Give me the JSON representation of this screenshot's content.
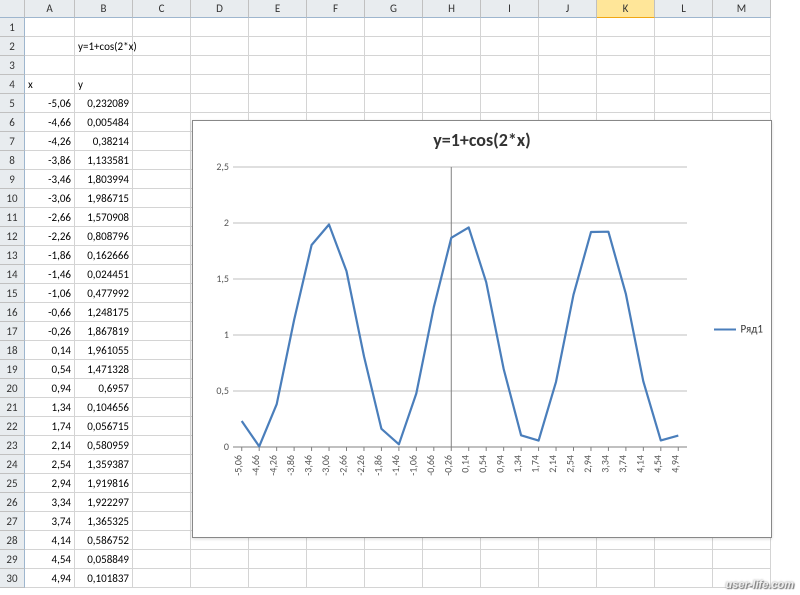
{
  "columns": [
    "A",
    "B",
    "C",
    "D",
    "E",
    "F",
    "G",
    "H",
    "I",
    "J",
    "K",
    "L",
    "M"
  ],
  "selected_column": "K",
  "row_start": 1,
  "row_end": 30,
  "cells": {
    "B2": "y=1+cos(2*x)",
    "A4": "x",
    "B4": "y"
  },
  "table_start_row": 5,
  "table": [
    {
      "x": "-5,06",
      "y": "0,232089"
    },
    {
      "x": "-4,66",
      "y": "0,005484"
    },
    {
      "x": "-4,26",
      "y": "0,38214"
    },
    {
      "x": "-3,86",
      "y": "1,133581"
    },
    {
      "x": "-3,46",
      "y": "1,803994"
    },
    {
      "x": "-3,06",
      "y": "1,986715"
    },
    {
      "x": "-2,66",
      "y": "1,570908"
    },
    {
      "x": "-2,26",
      "y": "0,808796"
    },
    {
      "x": "-1,86",
      "y": "0,162666"
    },
    {
      "x": "-1,46",
      "y": "0,024451"
    },
    {
      "x": "-1,06",
      "y": "0,477992"
    },
    {
      "x": "-0,66",
      "y": "1,248175"
    },
    {
      "x": "-0,26",
      "y": "1,867819"
    },
    {
      "x": "0,14",
      "y": "1,961055"
    },
    {
      "x": "0,54",
      "y": "1,471328"
    },
    {
      "x": "0,94",
      "y": "0,6957"
    },
    {
      "x": "1,34",
      "y": "0,104656"
    },
    {
      "x": "1,74",
      "y": "0,056715"
    },
    {
      "x": "2,14",
      "y": "0,580959"
    },
    {
      "x": "2,54",
      "y": "1,359387"
    },
    {
      "x": "2,94",
      "y": "1,919816"
    },
    {
      "x": "3,34",
      "y": "1,922297"
    },
    {
      "x": "3,74",
      "y": "1,365325"
    },
    {
      "x": "4,14",
      "y": "0,586752"
    },
    {
      "x": "4,54",
      "y": "0,058849"
    },
    {
      "x": "4,94",
      "y": "0,101837"
    }
  ],
  "chart_data": {
    "type": "line",
    "title": "y=1+cos(2*x)",
    "xlabel": "",
    "ylabel": "",
    "legend_position": "right",
    "series": [
      {
        "name": "Ряд1",
        "color": "#4a7ebb",
        "values": [
          0.232089,
          0.005484,
          0.38214,
          1.133581,
          1.803994,
          1.986715,
          1.570908,
          0.808796,
          0.162666,
          0.024451,
          0.477992,
          1.248175,
          1.867819,
          1.961055,
          1.471328,
          0.6957,
          0.104656,
          0.056715,
          0.580959,
          1.359387,
          1.919816,
          1.922297,
          1.365325,
          0.586752,
          0.058849,
          0.101837
        ]
      }
    ],
    "categories": [
      "-5,06",
      "-4,66",
      "-4,26",
      "-3,86",
      "-3,46",
      "-3,06",
      "-2,66",
      "-2,26",
      "-1,86",
      "-1,46",
      "-1,06",
      "-0,66",
      "-0,26",
      "0,14",
      "0,54",
      "0,94",
      "1,34",
      "1,74",
      "2,14",
      "2,54",
      "2,94",
      "3,34",
      "3,74",
      "4,14",
      "4,54",
      "4,94"
    ],
    "ylim": [
      0,
      2.5
    ],
    "yticks": [
      0,
      0.5,
      1,
      1.5,
      2,
      2.5
    ],
    "ytick_labels": [
      "0",
      "0,5",
      "1",
      "1,5",
      "2",
      "2,5"
    ],
    "grid": true
  },
  "watermark": "user-life.com"
}
